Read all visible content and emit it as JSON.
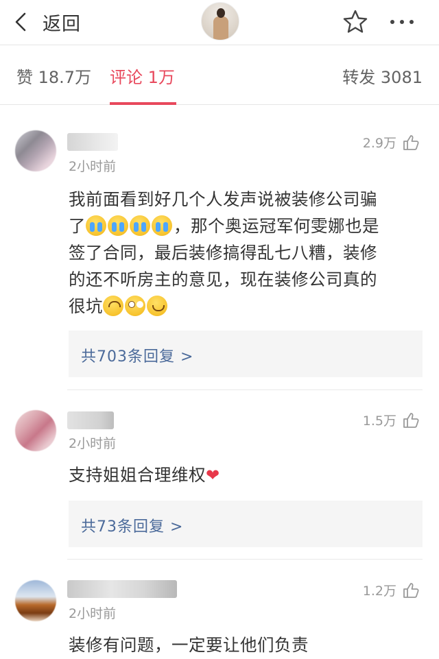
{
  "nav": {
    "back_label": "返回",
    "icons": [
      "chevron-left-icon",
      "avatar",
      "star-icon",
      "more-icon"
    ]
  },
  "tabs": [
    {
      "label": "赞 18.7万",
      "active": false
    },
    {
      "label": "评论 1万",
      "active": true
    },
    {
      "label": "转发 3081",
      "active": false
    }
  ],
  "colors": {
    "accent": "#e8485c",
    "link": "#4b6a9a",
    "muted": "#999999",
    "reply_bg": "#f5f5f5"
  },
  "comments": [
    {
      "time": "2小时前",
      "likes": "2.9万",
      "text_line1": "我前面看到好几个人发声说被装修公司骗",
      "text_seg2a": "了",
      "text_seg2b": "，那个奥运冠军何雯娜也是",
      "text_line3": "签了合同，最后装修搞得乱七八糟，装修",
      "text_line4": "的还不听房主的意见，现在装修公司真的",
      "text_seg5": "很坑",
      "replies": "共703条回复 >"
    },
    {
      "time": "2小时前",
      "likes": "1.5万",
      "text": "支持姐姐合理维权",
      "heart": "❤",
      "replies": "共73条回复 >"
    },
    {
      "time": "2小时前",
      "likes": "1.2万",
      "text": "装修有问题，一定要让他们负责"
    }
  ]
}
